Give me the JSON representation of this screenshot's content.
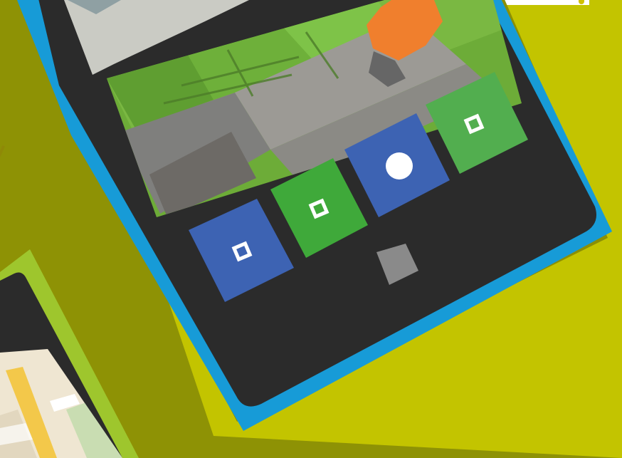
{
  "colors": {
    "background": "#c3c400",
    "shadow": "#8b8f05",
    "phone_frame": "#179bd7",
    "phone_body": "#2b2b2b",
    "tile_blue": "#3d63b3",
    "tile_green": "#3fa93a",
    "tile_green_light": "#52ae4f",
    "home_button": "#8a8a8a",
    "secondary_frame": "#9ec62d",
    "map_bg": "#efe6d2",
    "map_road": "#f3c84a"
  },
  "tiles": [
    {
      "icon": "square-icon",
      "color": "#3d63b3"
    },
    {
      "icon": "square-icon",
      "color": "#3fa93a"
    },
    {
      "icon": "circle-icon",
      "color": "#3d63b3"
    },
    {
      "icon": "square-icon",
      "color": "#52ae4f"
    }
  ],
  "home_button": {
    "icon": "home-button"
  },
  "photo_scene": {
    "description": ""
  }
}
